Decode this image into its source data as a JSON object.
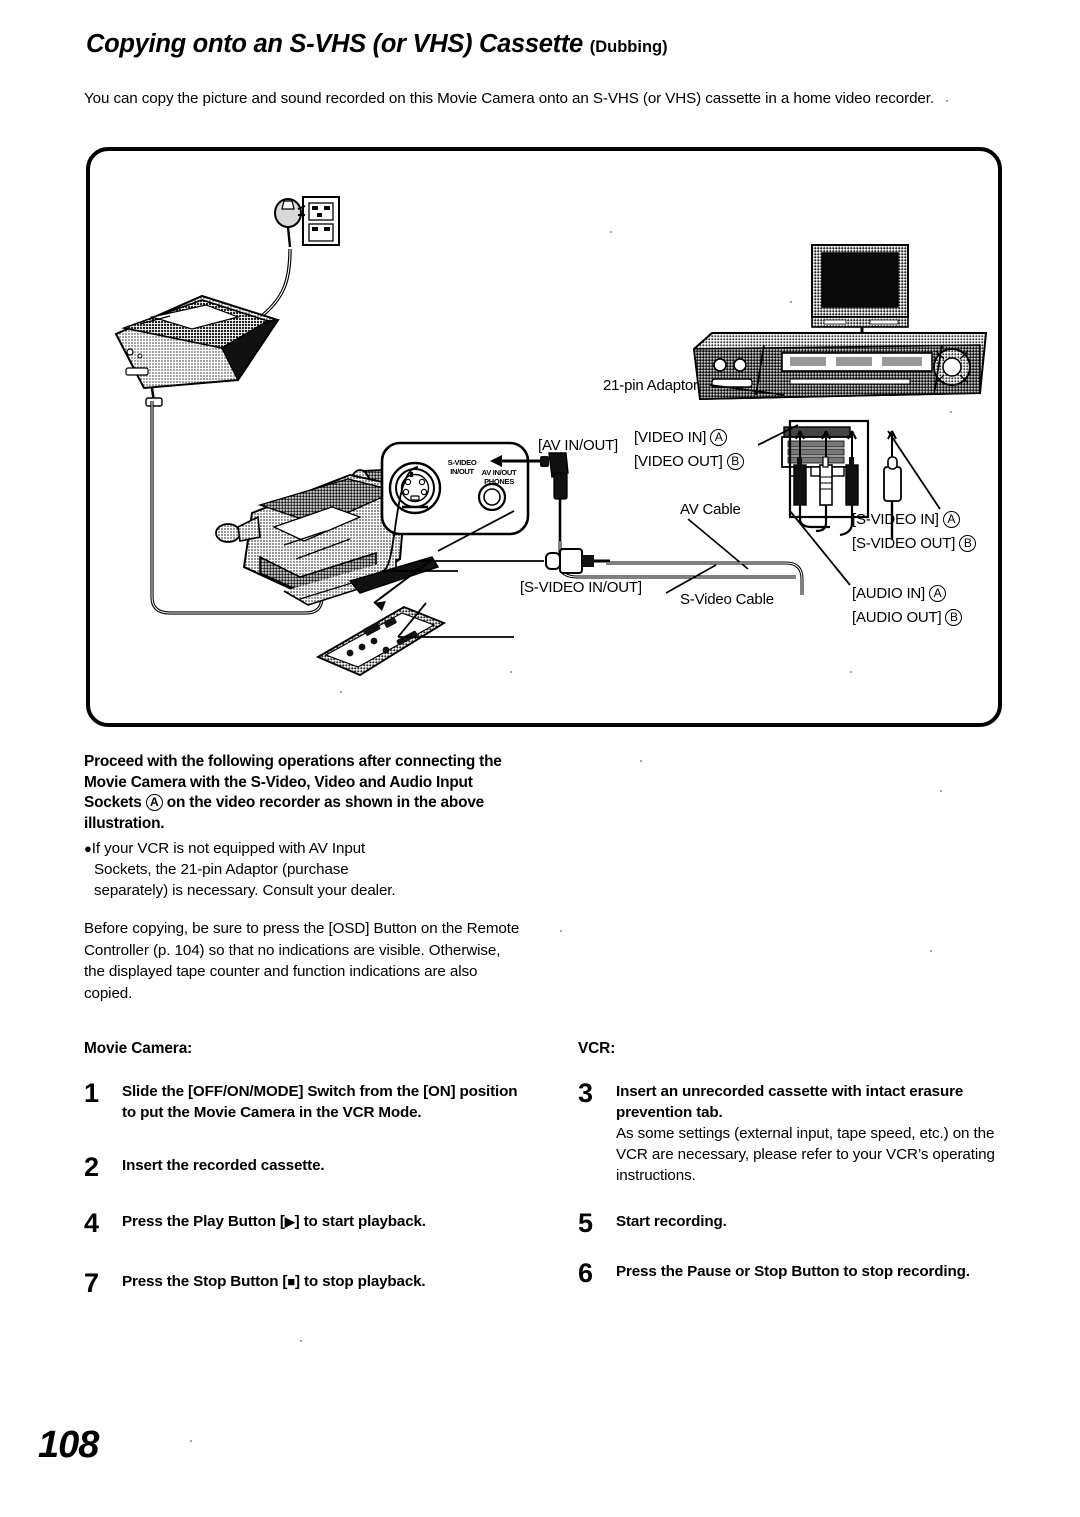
{
  "page": {
    "number": "108",
    "title_main": "Copying onto an S-VHS (or VHS) Cassette",
    "title_suffix": "(Dubbing)",
    "intro": "You can copy the picture and sound recorded on this Movie Camera onto an S-VHS (or VHS) cassette in a home video recorder."
  },
  "diagram": {
    "labels": {
      "socket_svideo": "S-VIDEO\nIN/OUT",
      "socket_av": "AV IN/OUT\nPHONES",
      "adaptor_21pin": "21-pin Adaptor",
      "av_in_out": "[AV IN/OUT]",
      "video_in": "[VIDEO IN]",
      "video_out": "[VIDEO OUT]",
      "av_cable": "AV Cable",
      "svideo_in_out": "[S-VIDEO IN/OUT]",
      "svideo_cable": "S-Video Cable",
      "svideo_in": "[S-VIDEO IN]",
      "svideo_out": "[S-VIDEO OUT]",
      "audio_in": "[AUDIO IN]",
      "audio_out": "[AUDIO OUT]",
      "mark_a": "A",
      "mark_b": "B"
    }
  },
  "notice": {
    "bold_text": "Proceed with the following operations after connecting the Movie Camera with the S-Video, Video and Audio Input Sockets",
    "bold_text_after_mark": "on the video recorder as shown in the above illustration.",
    "mark_a": "A",
    "bullet_line1": "If your VCR is not equipped with AV Input",
    "bullet_line2": "Sockets, the 21-pin Adaptor (purchase",
    "bullet_line3": "separately) is necessary. Consult your dealer.",
    "paragraph": "Before copying, be sure to press the [OSD] Button on the Remote Controller (p. 104) so that no indications are visible. Otherwise, the displayed tape counter and function indications are also copied."
  },
  "columns": {
    "left_heading": "Movie Camera:",
    "right_heading": "VCR:",
    "left_steps": [
      {
        "number": "1",
        "text": "Slide the [OFF/ON/MODE] Switch from the [ON] position to put the Movie Camera in the VCR Mode.",
        "sub": ""
      },
      {
        "number": "2",
        "text": "Insert the recorded cassette.",
        "sub": ""
      },
      {
        "number": "4",
        "text_pre": "Press the Play Button [",
        "glyph": "▶",
        "text_post": "] to start playback.",
        "sub": ""
      },
      {
        "number": "7",
        "text_pre": "Press the Stop Button [",
        "glyph": "■",
        "text_post": "] to stop playback.",
        "sub": ""
      }
    ],
    "right_steps": [
      {
        "number": "3",
        "text": "Insert an unrecorded cassette with intact erasure prevention tab.",
        "sub": "As some settings (external input, tape speed, etc.) on the VCR are necessary, please refer to your VCR’s operating instructions."
      },
      {
        "number": "5",
        "text": "Start recording.",
        "sub": ""
      },
      {
        "number": "6",
        "text": "Press the Pause or Stop Button to stop recording.",
        "sub": ""
      }
    ]
  }
}
